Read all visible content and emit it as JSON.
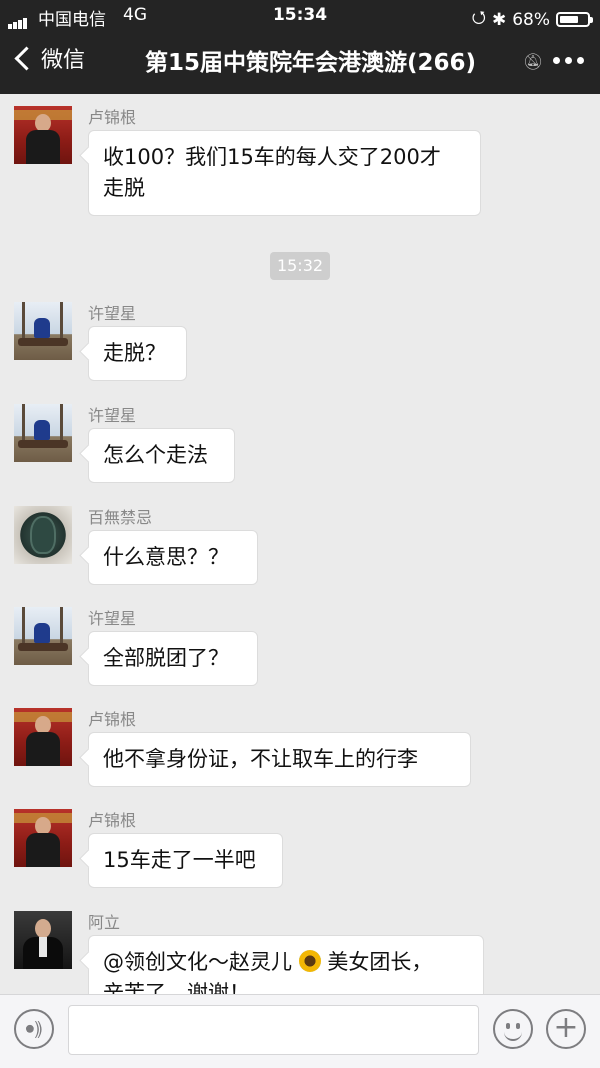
{
  "status_bar": {
    "carrier": "中国电信",
    "network": "4G",
    "time": "15:34",
    "battery": "68%",
    "battery_level": 0.68
  },
  "nav": {
    "back_label": "微信",
    "title": "第15届中策院年会港澳游(266)"
  },
  "messages": [
    {
      "sender": "卢锦根",
      "avatar": "red-stage-portrait",
      "lines": [
        "收100？我们15车的每人交了200才",
        "走脱"
      ]
    },
    {
      "sender": "许望星",
      "avatar": "snow-scene-portrait",
      "lines": [
        "走脱？"
      ]
    },
    {
      "sender": "许望星",
      "avatar": "snow-scene-portrait",
      "lines": [
        "怎么个走法"
      ]
    },
    {
      "sender": "百無禁忌",
      "avatar": "jade-carving",
      "lines": [
        "什么意思？？"
      ]
    },
    {
      "sender": "许望星",
      "avatar": "snow-scene-portrait",
      "lines": [
        "全部脱团了？"
      ]
    },
    {
      "sender": "卢锦根",
      "avatar": "red-stage-portrait",
      "lines": [
        "他不拿身份证，不让取车上的行李"
      ]
    },
    {
      "sender": "卢锦根",
      "avatar": "red-stage-portrait",
      "lines": [
        "15车走了一半吧"
      ]
    },
    {
      "sender": "阿立",
      "avatar": "suit-portrait",
      "lines": [
        "@领创文化～赵灵儿",
        "美女团长，",
        "辛苦了，谢谢！"
      ]
    }
  ],
  "timestamp": "15:32",
  "icons": {
    "voice": "voice-icon",
    "emoji": "emoji-icon",
    "plus": "plus-icon",
    "mute": "mute-icon",
    "more": "more-icon",
    "sunflower": "sunflower-icon"
  }
}
